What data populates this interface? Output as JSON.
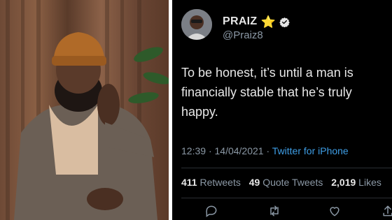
{
  "photo": {
    "subject": "portrait-photo"
  },
  "tweet": {
    "display_name": "PRAIZ",
    "name_emoji": "⭐",
    "handle": "@Praiz8",
    "text": "To be honest, it’s until a man is financially stable that he’s truly happy.",
    "time": "12:39",
    "dot": "·",
    "date": "14/04/2021",
    "source": "Twitter for iPhone",
    "stats": {
      "retweets_count": "411",
      "retweets_label": "Retweets",
      "quotes_count": "49",
      "quotes_label": "Quote Tweets",
      "likes_count": "2,019",
      "likes_label": "Likes"
    },
    "actions": [
      "reply-icon",
      "retweet-icon",
      "like-icon",
      "share-icon"
    ]
  },
  "colors": {
    "background": "#000000",
    "text": "#e8e8e8",
    "muted": "#8b98a5",
    "link": "#3e9ee6",
    "verified": "#e6e6e6"
  }
}
